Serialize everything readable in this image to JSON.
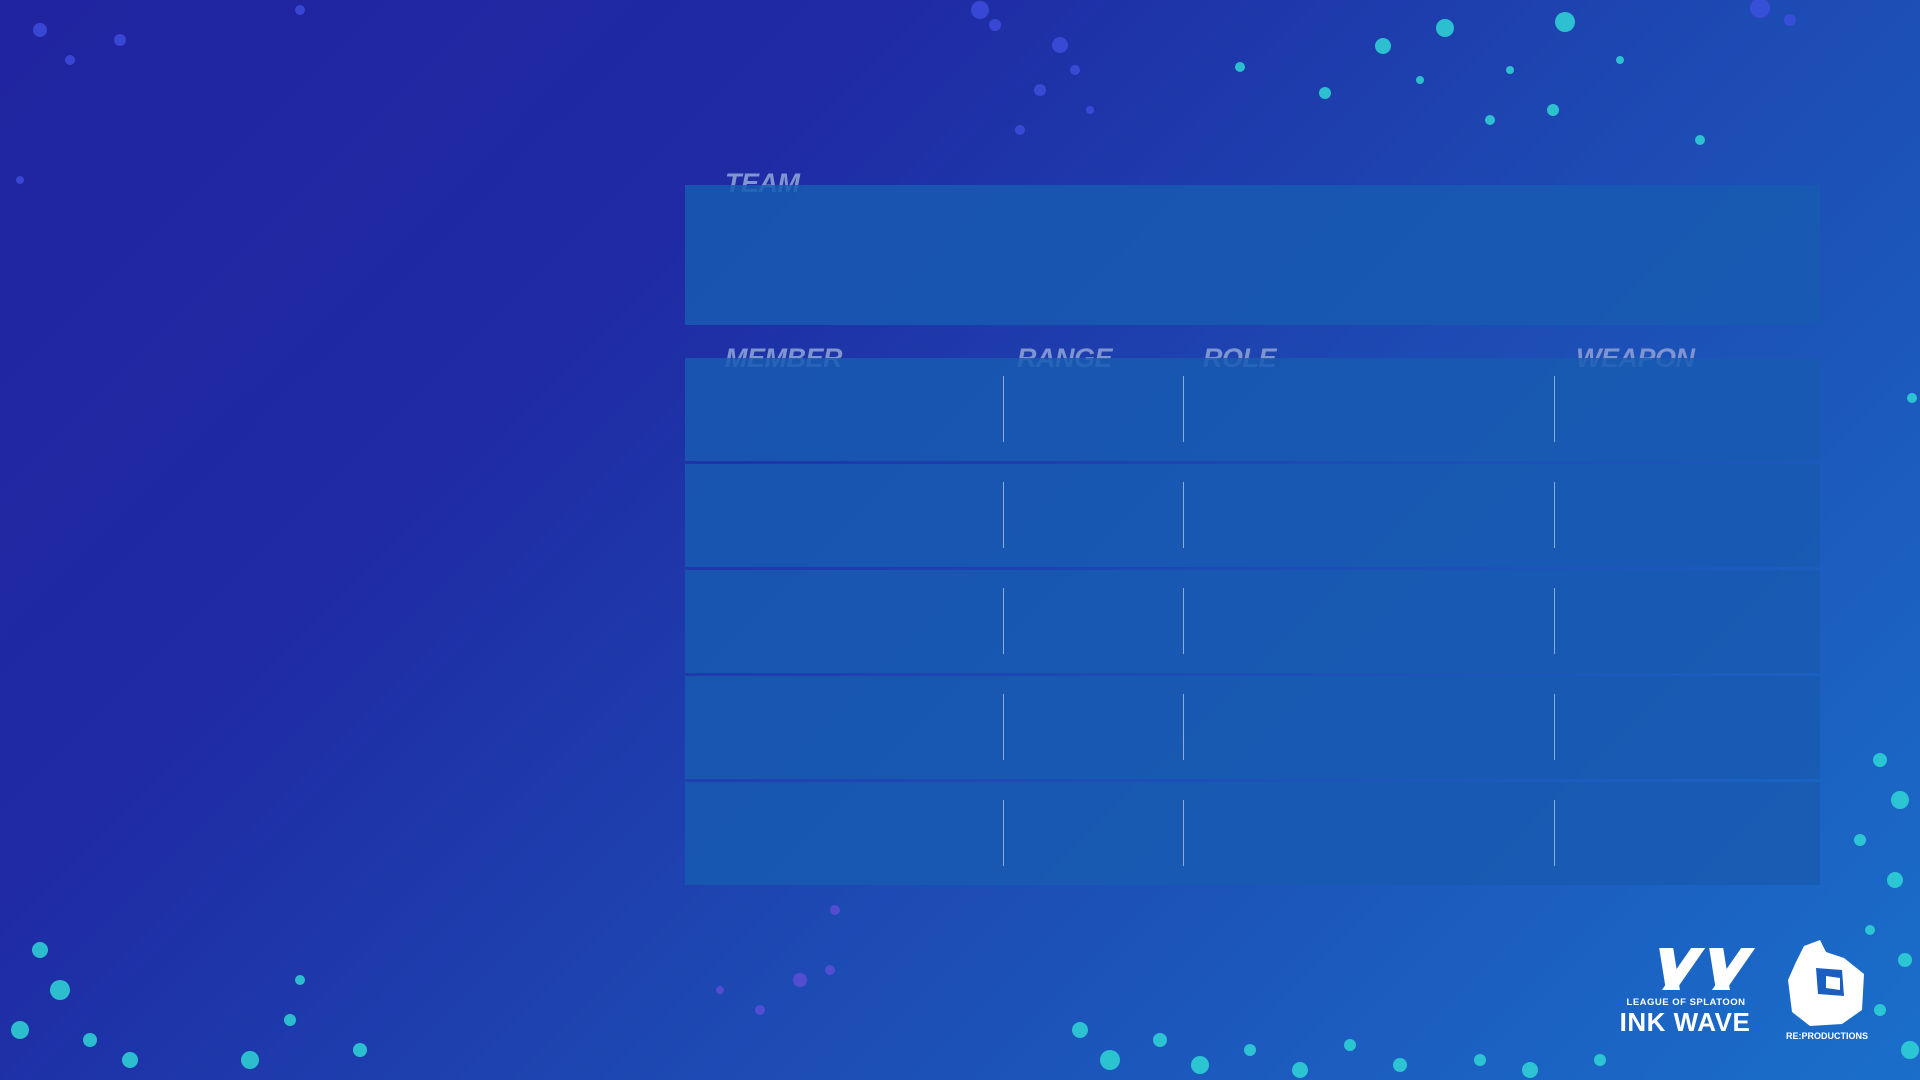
{
  "team_section": {
    "label": "TEAM"
  },
  "table": {
    "columns": [
      {
        "label": "MEMBER"
      },
      {
        "label": "RANGE"
      },
      {
        "label": "ROLE"
      },
      {
        "label": "WEAPON"
      }
    ],
    "rows": [
      {
        "member": "",
        "range": "",
        "role": "",
        "weapon": ""
      },
      {
        "member": "",
        "range": "",
        "role": "",
        "weapon": ""
      },
      {
        "member": "",
        "range": "",
        "role": "",
        "weapon": ""
      },
      {
        "member": "",
        "range": "",
        "role": "",
        "weapon": ""
      },
      {
        "member": "",
        "range": "",
        "role": "",
        "weapon": ""
      }
    ]
  },
  "logos": {
    "ink_wave": {
      "subtitle": "LEAGUE OF SPLATOON",
      "title": "INK WAVE"
    },
    "reproductions": {
      "caption": "RE:PRODUCTIONS"
    }
  },
  "colors": {
    "background_start": "#2024a0",
    "background_end": "#1a6fca",
    "panel": "#1b5ab2",
    "label": "#7f95d0",
    "splatter_cyan": "#2fd6d6",
    "splatter_blue": "#3f4fe0",
    "splatter_purple": "#6a4fe0"
  }
}
